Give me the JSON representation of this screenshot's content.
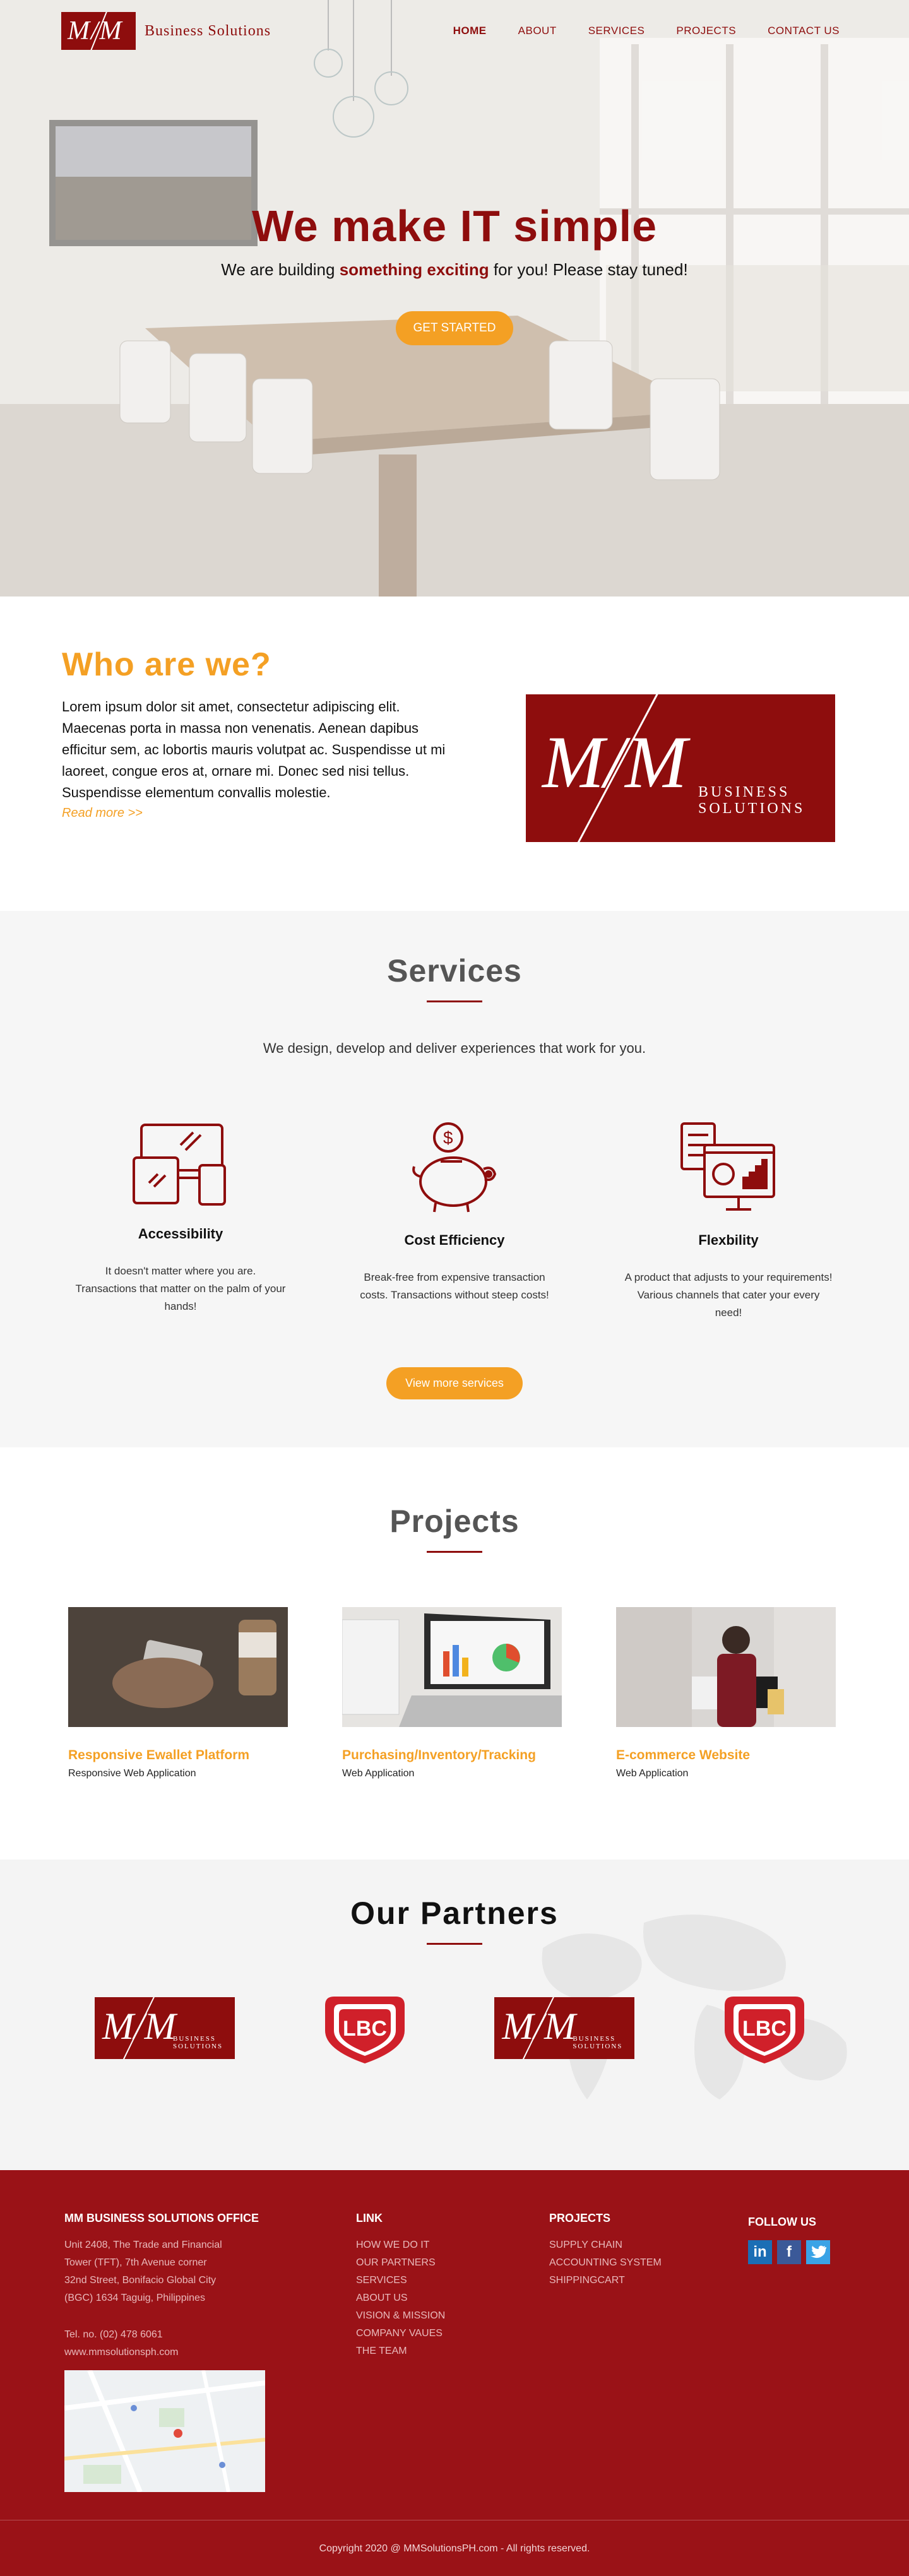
{
  "nav": {
    "brand_mark": "M/M",
    "brand_name": "Business Solutions",
    "links": [
      "HOME",
      "ABOUT",
      "SERVICES",
      "PROJECTS",
      "CONTACT US"
    ]
  },
  "hero": {
    "title": "We make IT simple",
    "subtitle_pre": "We are building ",
    "subtitle_strong": "something exciting",
    "subtitle_post": " for you! Please stay tuned!",
    "button": "GET STARTED"
  },
  "who": {
    "title": "Who are we?",
    "body": "Lorem ipsum dolor sit amet, consectetur adipiscing elit. Maecenas porta in massa non venenatis. Aenean dapibus efficitur sem, ac lobortis mauris volutpat ac. Suspendisse ut mi laoreet, congue eros at, ornare mi. Donec sed nisi tellus. Suspendisse elementum convallis molestie.",
    "read_more": "Read more >>",
    "logo_mark": "M/M",
    "logo_line1": "BUSINESS",
    "logo_line2": "SOLUTIONS"
  },
  "services": {
    "title": "Services",
    "subtitle": "We design, develop and deliver experiences that work for you.",
    "items": [
      {
        "title": "Accessibility",
        "desc": "It doesn't matter where you are. Transactions that matter on the palm of your hands!"
      },
      {
        "title": "Cost Efficiency",
        "desc": "Break-free from expensive transaction costs. Transactions without steep costs!"
      },
      {
        "title": "Flexbility",
        "desc": "A product that adjusts to your requirements! Various channels that cater your every need!"
      }
    ],
    "button": "View more services"
  },
  "projects": {
    "title": "Projects",
    "items": [
      {
        "title": "Responsive Ewallet Platform",
        "type": "Responsive Web Application"
      },
      {
        "title": "Purchasing/Inventory/Tracking",
        "type": "Web Application"
      },
      {
        "title": "E-commerce Website",
        "type": "Web Application"
      }
    ]
  },
  "partners": {
    "title": "Our Partners",
    "mm_mark": "M/M",
    "mm_line1": "BUSINESS",
    "mm_line2": "SOLUTIONS",
    "lbc_text": "LBC"
  },
  "footer": {
    "office_heading": "MM BUSINESS SOLUTIONS OFFICE",
    "address": [
      "Unit 2408, The Trade and Financial",
      "Tower (TFT), 7th Avenue corner",
      "32nd Street, Bonifacio Global City",
      "(BGC) 1634 Taguig, Philippines"
    ],
    "tel": "Tel. no. (02) 478 6061",
    "website": "www.mmsolutionsph.com",
    "link_heading": "LINK",
    "links": [
      "HOW WE DO IT",
      "OUR PARTNERS",
      "SERVICES",
      "ABOUT US",
      "VISION & MISSION",
      "COMPANY VAUES",
      "THE TEAM"
    ],
    "projects_heading": "PROJECTS",
    "projects": [
      "SUPPLY CHAIN",
      "ACCOUNTING SYSTEM",
      "SHIPPINGCART"
    ],
    "follow_heading": "FOLLOW US",
    "social": [
      "in",
      "f",
      "t"
    ],
    "copyright": "Copyright 2020 @ MMSolutionsPH.com - All rights reserved."
  },
  "colors": {
    "brand_red": "#8e0d0d",
    "footer_red": "#9a1217",
    "accent_orange": "#f4a024"
  }
}
